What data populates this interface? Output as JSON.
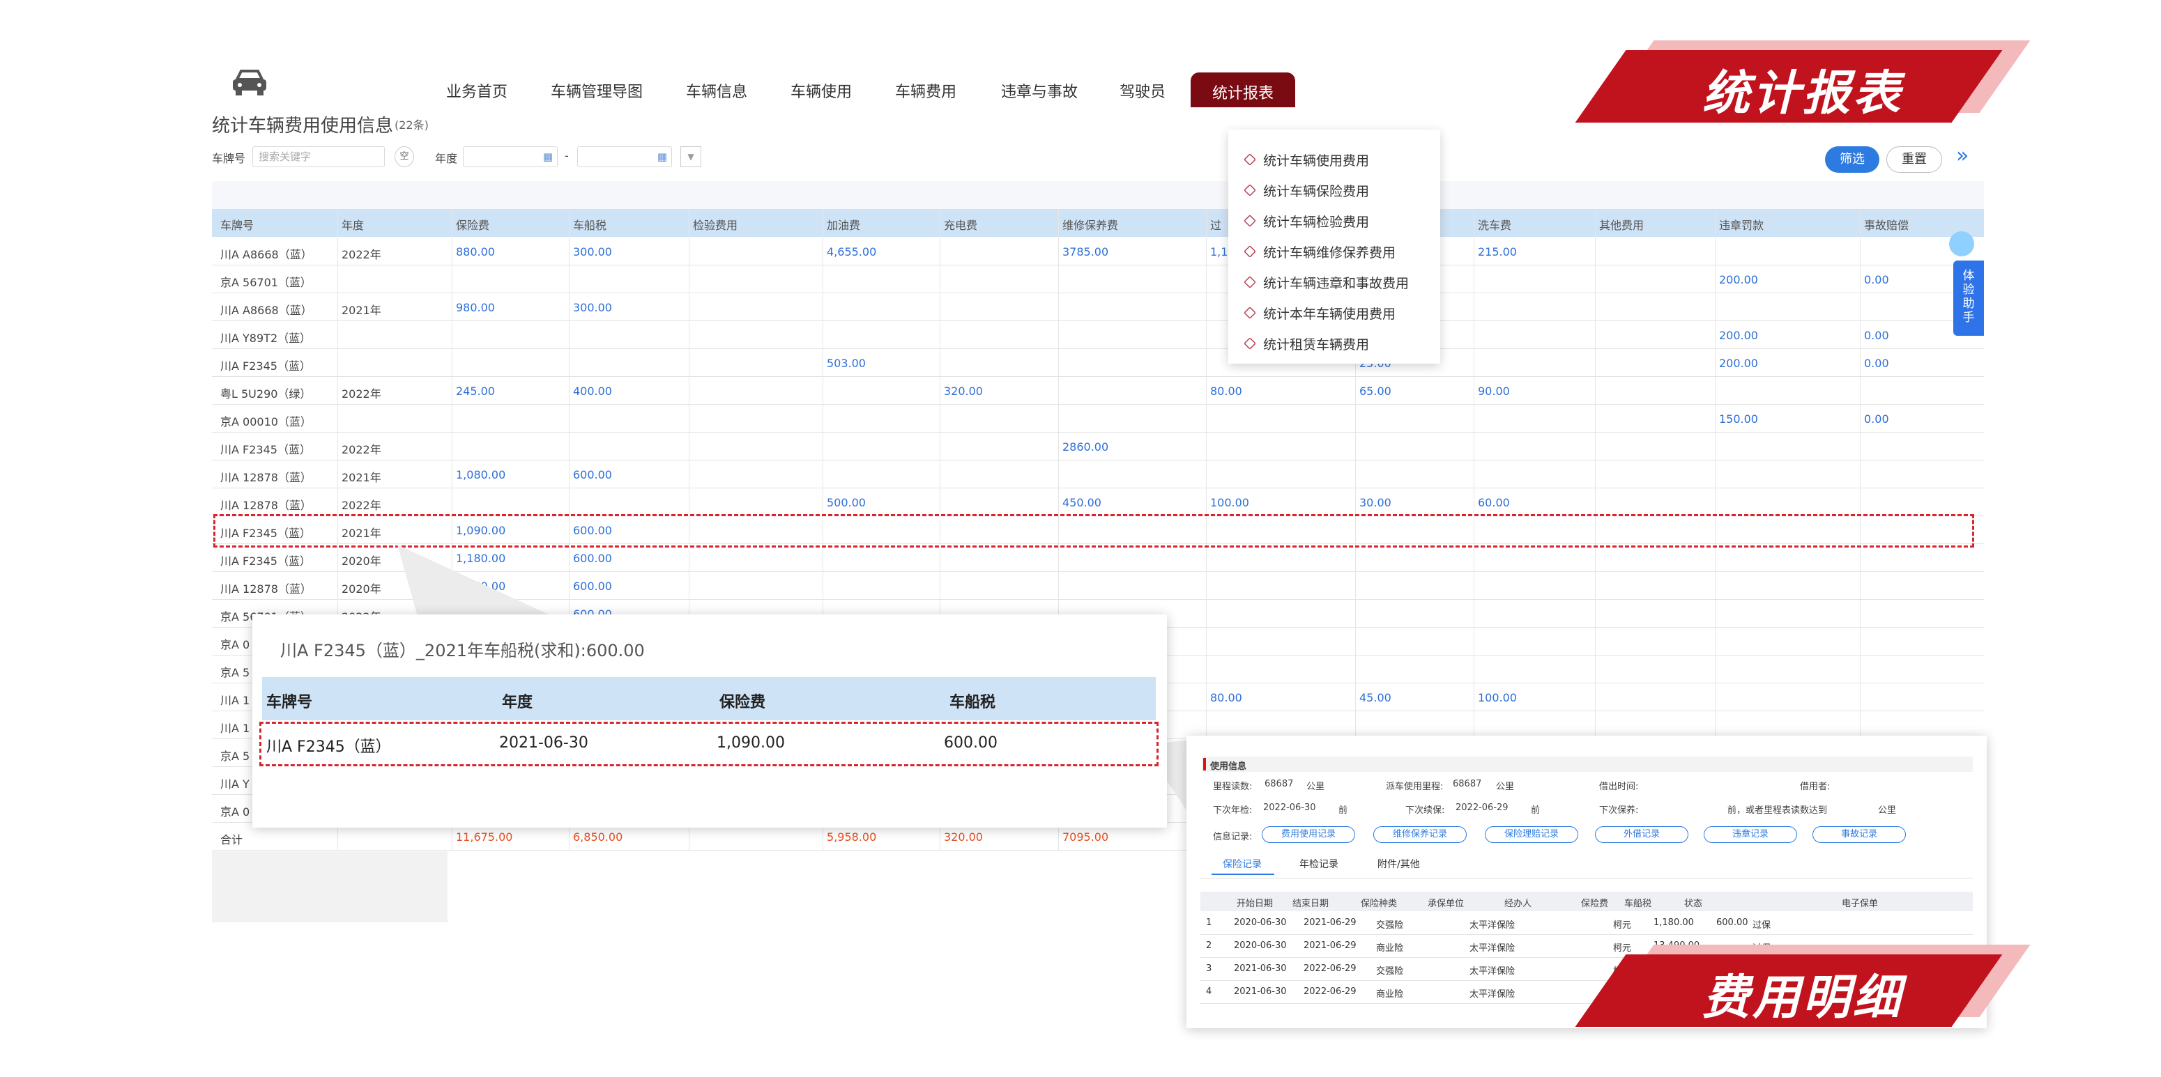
{
  "nav": {
    "items": [
      "业务首页",
      "车辆管理导图",
      "车辆信息",
      "车辆使用",
      "车辆费用",
      "违章与事故",
      "驾驶员"
    ],
    "active": "统计报表"
  },
  "page": {
    "title": "统计车辆费用使用信息",
    "count": "(22条)",
    "filters": {
      "plate_label": "车牌号",
      "plate_placeholder": "搜索关键字",
      "year_label": "年度",
      "dash": "-",
      "empty_btn": "空"
    },
    "buttons": {
      "filter": "筛选",
      "reset": "重置",
      "more": "»"
    }
  },
  "table": {
    "columns": [
      "车牌号",
      "年度",
      "保险费",
      "车船税",
      "检验费用",
      "加油费",
      "充电费",
      "维修保养费",
      "过",
      "",
      "洗车费",
      "其他费用",
      "违章罚款",
      "事故赔偿"
    ],
    "rows": [
      {
        "plate": "川A A8668（蓝）",
        "year": "2022年",
        "ins": "880.00",
        "tax": "300.00",
        "fuel": "4,655.00",
        "charge": "",
        "maint": "3785.00",
        "toll": "1,1",
        "park": "",
        "wash": "215.00",
        "fine": "",
        "acc": ""
      },
      {
        "plate": "京A 56701（蓝）",
        "year": "",
        "ins": "",
        "tax": "",
        "fuel": "",
        "charge": "",
        "maint": "",
        "toll": "",
        "park": "",
        "wash": "",
        "fine": "200.00",
        "acc": "0.00"
      },
      {
        "plate": "川A A8668（蓝）",
        "year": "2021年",
        "ins": "980.00",
        "tax": "300.00",
        "fuel": "",
        "charge": "",
        "maint": "",
        "toll": "",
        "park": "",
        "wash": "",
        "fine": "",
        "acc": ""
      },
      {
        "plate": "川A Y89T2（蓝）",
        "year": "",
        "ins": "",
        "tax": "",
        "fuel": "",
        "charge": "",
        "maint": "",
        "toll": "",
        "park": "",
        "wash": "",
        "fine": "200.00",
        "acc": "0.00"
      },
      {
        "plate": "川A F2345（蓝）",
        "year": "",
        "ins": "",
        "tax": "",
        "fuel": "503.00",
        "charge": "",
        "maint": "",
        "toll": "",
        "park": "25.00",
        "wash": "",
        "fine": "200.00",
        "acc": "0.00"
      },
      {
        "plate": "粤L 5U290（绿）",
        "year": "2022年",
        "ins": "245.00",
        "tax": "400.00",
        "fuel": "",
        "charge": "320.00",
        "maint": "",
        "toll": "80.00",
        "park": "65.00",
        "wash": "90.00",
        "fine": "",
        "acc": ""
      },
      {
        "plate": "京A 00010（蓝）",
        "year": "",
        "ins": "",
        "tax": "",
        "fuel": "",
        "charge": "",
        "maint": "",
        "toll": "",
        "park": "",
        "wash": "",
        "fine": "150.00",
        "acc": "0.00"
      },
      {
        "plate": "川A F2345（蓝）",
        "year": "2022年",
        "ins": "",
        "tax": "",
        "fuel": "",
        "charge": "",
        "maint": "2860.00",
        "toll": "",
        "park": "",
        "wash": "",
        "fine": "",
        "acc": ""
      },
      {
        "plate": "川A 12878（蓝）",
        "year": "2021年",
        "ins": "1,080.00",
        "tax": "600.00",
        "fuel": "",
        "charge": "",
        "maint": "",
        "toll": "",
        "park": "",
        "wash": "",
        "fine": "",
        "acc": ""
      },
      {
        "plate": "川A 12878（蓝）",
        "year": "2022年",
        "ins": "",
        "tax": "",
        "fuel": "500.00",
        "charge": "",
        "maint": "450.00",
        "toll": "100.00",
        "park": "30.00",
        "wash": "60.00",
        "fine": "",
        "acc": ""
      },
      {
        "plate": "川A F2345（蓝）",
        "year": "2021年",
        "ins": "1,090.00",
        "tax": "600.00",
        "fuel": "",
        "charge": "",
        "maint": "",
        "toll": "",
        "park": "",
        "wash": "",
        "fine": "",
        "acc": ""
      },
      {
        "plate": "川A F2345（蓝）",
        "year": "2020年",
        "ins": "1,180.00",
        "tax": "600.00",
        "fuel": "",
        "charge": "",
        "maint": "",
        "toll": "",
        "park": "",
        "wash": "",
        "fine": "",
        "acc": ""
      },
      {
        "plate": "川A 12878（蓝）",
        "year": "2020年",
        "ins": "1,260.00",
        "tax": "600.00",
        "fuel": "",
        "charge": "",
        "maint": "",
        "toll": "",
        "park": "",
        "wash": "",
        "fine": "",
        "acc": ""
      },
      {
        "plate": "京A 56701（蓝）",
        "year": "2022年",
        "ins": "",
        "tax": "600.00",
        "fuel": "",
        "charge": "",
        "maint": "",
        "toll": "",
        "park": "",
        "wash": "",
        "fine": "",
        "acc": ""
      },
      {
        "plate": "京A 0",
        "year": "",
        "ins": "",
        "tax": "",
        "fuel": "",
        "charge": "",
        "maint": "",
        "toll": "",
        "park": "",
        "wash": "",
        "fine": "",
        "acc": ""
      },
      {
        "plate": "京A 5",
        "year": "",
        "ins": "",
        "tax": "",
        "fuel": "",
        "charge": "",
        "maint": "",
        "toll": "",
        "park": "",
        "wash": "",
        "fine": "",
        "acc": ""
      },
      {
        "plate": "川A 1",
        "year": "",
        "ins": "",
        "tax": "",
        "fuel": "",
        "charge": "",
        "maint": "",
        "toll": "80.00",
        "park": "45.00",
        "wash": "100.00",
        "fine": "",
        "acc": ""
      },
      {
        "plate": "川A 1",
        "year": "",
        "ins": "",
        "tax": "",
        "fuel": "",
        "charge": "",
        "maint": "",
        "toll": "",
        "park": "",
        "wash": "",
        "fine": "",
        "acc": ""
      },
      {
        "plate": "京A 5",
        "year": "",
        "ins": "",
        "tax": "",
        "fuel": "",
        "charge": "",
        "maint": "",
        "toll": "",
        "park": "",
        "wash": "",
        "fine": "",
        "acc": ""
      },
      {
        "plate": "川A Y",
        "year": "",
        "ins": "",
        "tax": "",
        "fuel": "",
        "charge": "",
        "maint": "",
        "toll": "",
        "park": "",
        "wash": "",
        "fine": "",
        "acc": ""
      },
      {
        "plate": "京A 0",
        "year": "",
        "ins": "",
        "tax": "",
        "fuel": "",
        "charge": "",
        "maint": "",
        "toll": "",
        "park": "",
        "wash": "",
        "fine": "",
        "acc": ""
      }
    ],
    "total": {
      "label": "合计",
      "ins": "11,675.00",
      "tax": "6,850.00",
      "fuel": "5,958.00",
      "charge": "320.00",
      "maint": "7095.00"
    }
  },
  "menu": [
    "统计车辆使用费用",
    "统计车辆保险费用",
    "统计车辆检验费用",
    "统计车辆维修保养费用",
    "统计车辆违章和事故费用",
    "统计本年车辆使用费用",
    "统计租赁车辆费用"
  ],
  "banners": {
    "top": "统计报表",
    "bottom": "费用明细"
  },
  "helper": "体验助手",
  "popup1": {
    "header": "川A F2345（蓝）_2021年车船税(求和):600.00",
    "columns": [
      "车牌号",
      "年度",
      "保险费",
      "车船税"
    ],
    "row": [
      "川A F2345（蓝）",
      "2021-06-30",
      "1,090.00",
      "600.00"
    ]
  },
  "popup2": {
    "section": "使用信息",
    "mileage_label": "里程读数:",
    "mileage": "68687",
    "unit": "公里",
    "dispatch_label": "派车使用里程:",
    "dispatch": "68687",
    "out_time_label": "借出时间:",
    "borrower_label": "借用者:",
    "next_check_label": "下次年检:",
    "next_check": "2022-06-30",
    "before": "前",
    "next_renew_label": "下次续保:",
    "next_renew": "2022-06-29",
    "next_maint_label": "下次保养:",
    "maint_note": "前，或者里程表读数达到",
    "records_label": "信息记录:",
    "pills": [
      "费用使用记录",
      "维修保养记录",
      "保险理赔记录",
      "外借记录",
      "违章记录",
      "事故记录"
    ],
    "tabs": [
      "保险记录",
      "年检记录",
      "附件/其他"
    ],
    "grid_cols": [
      "开始日期",
      "结束日期",
      "保险种类",
      "承保单位",
      "经办人",
      "保险费",
      "车船税",
      "状态",
      "电子保单"
    ],
    "grid_rows": [
      [
        "1",
        "2020-06-30",
        "2021-06-29",
        "交强险",
        "太平洋保险",
        "柯元",
        "1,180.00",
        "600.00",
        "过保"
      ],
      [
        "2",
        "2020-06-30",
        "2021-06-29",
        "商业险",
        "太平洋保险",
        "柯元",
        "13,490.00",
        "",
        "过保"
      ],
      [
        "3",
        "2021-06-30",
        "2022-06-29",
        "交强险",
        "太平洋保险",
        "柯元",
        "",
        "",
        ""
      ],
      [
        "4",
        "2021-06-30",
        "2022-06-29",
        "商业险",
        "太平洋保险",
        "柯元",
        "",
        "",
        ""
      ]
    ]
  }
}
